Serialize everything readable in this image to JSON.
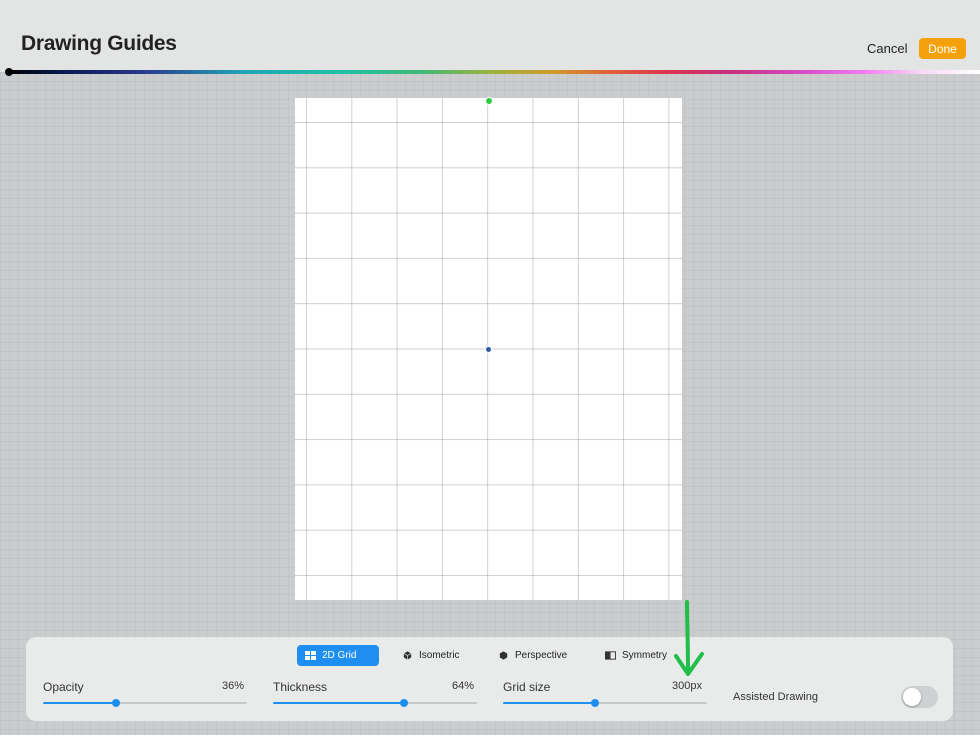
{
  "header": {
    "title": "Drawing Guides",
    "cancel_label": "Cancel",
    "done_label": "Done",
    "done_color": "#f5a10b"
  },
  "tabs": [
    {
      "label": "2D Grid",
      "icon": "grid-icon",
      "active": true
    },
    {
      "label": "Isometric",
      "icon": "cube-icon",
      "active": false
    },
    {
      "label": "Perspective",
      "icon": "hexagon-icon",
      "active": false
    },
    {
      "label": "Symmetry",
      "icon": "symmetry-icon",
      "active": false
    }
  ],
  "sliders": [
    {
      "label": "Opacity",
      "value_text": "36%",
      "value": 0.36
    },
    {
      "label": "Thickness",
      "value_text": "64%",
      "value": 0.64
    },
    {
      "label": "Grid size",
      "value_text": "300px",
      "value": 0.45
    }
  ],
  "assisted_drawing": {
    "label": "Assisted Drawing",
    "enabled": false
  },
  "accent_color": "#1f8ef1",
  "annotation": {
    "icon": "green-arrow-down-icon",
    "color": "#1fbf4a"
  }
}
